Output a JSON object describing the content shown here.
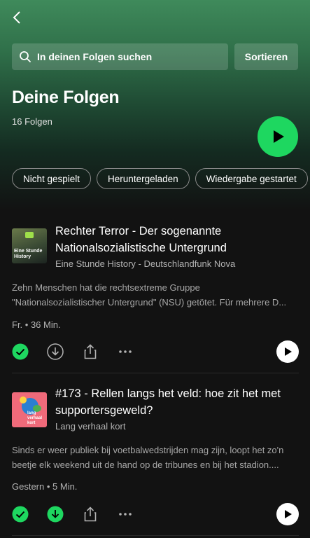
{
  "header": {
    "search_placeholder": "In deinen Folgen suchen",
    "sort_label": "Sortieren",
    "title": "Deine Folgen",
    "count": "16 Folgen"
  },
  "filters": [
    "Nicht gespielt",
    "Heruntergeladen",
    "Wiedergabe gestartet"
  ],
  "episodes": [
    {
      "title": "Rechter Terror - Der sogenannte Nationalsozialistische Untergrund",
      "show": "Eine Stunde History - Deutschlandfunk Nova",
      "cover_text": "Eine Stunde History",
      "desc_1": "Zehn Menschen hat die rechtsextreme Gruppe",
      "desc_2": "\"Nationalsozialistischer Untergrund\" (NSU) getötet. Für mehrere D...",
      "meta": "Fr. • 36 Min.",
      "downloaded": false
    },
    {
      "title": "#173 - Rellen langs het veld: hoe zit het met supportersgeweld?",
      "show": "Lang verhaal kort",
      "cover_text": "lang verhaal kort",
      "desc_1": "Sinds er weer publiek bij voetbalwedstrijden mag zijn, loopt het zo'n",
      "desc_2": "beetje elk weekend uit de hand op de tribunes en bij het stadion....",
      "meta": "Gestern • 5 Min.",
      "downloaded": true
    }
  ],
  "colors": {
    "accent": "#1ed760",
    "background": "#121212"
  }
}
